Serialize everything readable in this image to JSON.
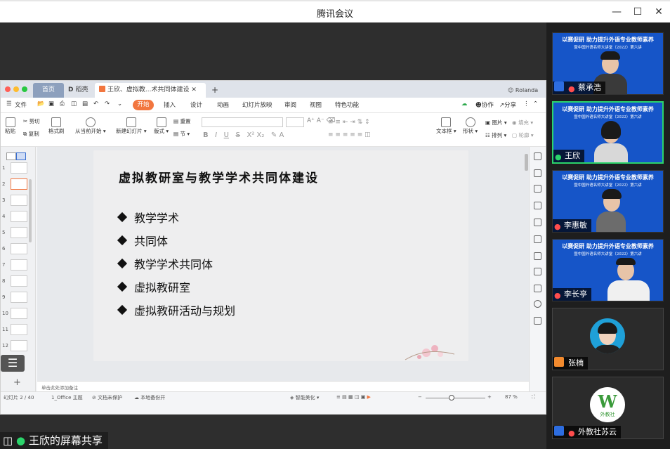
{
  "window": {
    "title": "腾讯会议"
  },
  "wps": {
    "tabs": {
      "home": "首页",
      "docer": "稻壳",
      "doc": "王欣、虚拟教...术共同体建设"
    },
    "user": "Rolanda",
    "menu": [
      "文件",
      "开始",
      "插入",
      "设计",
      "动画",
      "幻灯片放映",
      "审阅",
      "视图",
      "特色功能"
    ],
    "menu_right": {
      "collab": "协作",
      "share": "分享"
    },
    "toolbar": {
      "paste": "粘贴",
      "cut": "剪切",
      "copy": "复制",
      "format_painter": "格式刷",
      "play_from_current": "从当前开始",
      "new_slide": "新建幻灯片",
      "layout": "版式",
      "reset": "重置",
      "section": "节",
      "textbox": "文本框",
      "shape": "形状",
      "image": "图片",
      "fill": "填充",
      "arrange": "排列",
      "outline": "轮廓"
    },
    "slide_numbers": [
      "1",
      "2",
      "3",
      "4",
      "5",
      "6",
      "7",
      "8",
      "9",
      "10",
      "11",
      "12"
    ],
    "slide": {
      "title": "虚拟教研室与教学学术共同体建设",
      "bullets": [
        "教学学术",
        "共同体",
        "教学学术共同体",
        "虚拟教研室",
        "虚拟教研活动与规划"
      ]
    },
    "notes_placeholder": "单击此处添加备注",
    "status": {
      "slide_pos": "幻灯片 2 / 40",
      "theme": "1_Office 主题",
      "unprotected": "文档未保护",
      "backup": "本地备份开",
      "beautify": "智能美化",
      "zoom": "87 %"
    }
  },
  "share_label": "王欣的屏幕共享",
  "participants": [
    {
      "name": "蔡承浩",
      "banner1": "以赛促研 助力提升外语专业教师素养",
      "banner2": "暨中国外语名师大讲堂（2022）第六讲",
      "type": "video"
    },
    {
      "name": "王欣",
      "banner1": "以赛促研 助力提升外语专业教师素养",
      "banner2": "暨中国外语名师大讲堂（2022）第六讲",
      "type": "video",
      "speaking": true
    },
    {
      "name": "李惠敏",
      "banner1": "以赛促研 助力提升外语专业教师素养",
      "banner2": "暨中国外语名师大讲堂（2022）第六讲",
      "type": "video"
    },
    {
      "name": "李长亭",
      "banner1": "以赛促研 助力提升外语专业教师素养",
      "banner2": "暨中国外语名师大讲堂（2022）第六讲",
      "type": "video"
    },
    {
      "name": "张楠",
      "type": "avatar"
    },
    {
      "name": "外教社苏云",
      "type": "avatar",
      "logo_text": "外教社"
    }
  ],
  "colors": {
    "accent_orange": "#f2763f",
    "tile_blue": "#1655c8",
    "speaking_green": "#2bd46b"
  }
}
